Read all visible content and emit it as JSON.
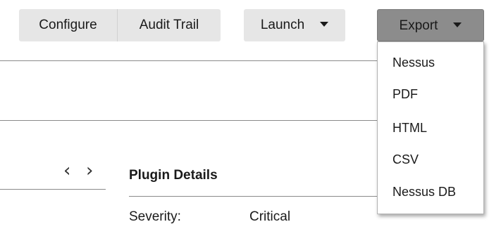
{
  "toolbar": {
    "configure_label": "Configure",
    "audit_trail_label": "Audit Trail",
    "launch_label": "Launch",
    "export_label": "Export"
  },
  "export_menu": {
    "items": [
      {
        "label": "Nessus"
      },
      {
        "label": "PDF"
      },
      {
        "label": "HTML"
      },
      {
        "label": "CSV"
      },
      {
        "label": "Nessus DB"
      }
    ]
  },
  "nav": {
    "prev_icon": "‹",
    "next_icon": "›"
  },
  "plugin_details": {
    "title": "Plugin Details",
    "severity_label": "Severity:",
    "severity_value": "Critical"
  },
  "colors": {
    "button_bg": "#e6e6e6",
    "export_active_bg": "#8c8c8c"
  }
}
